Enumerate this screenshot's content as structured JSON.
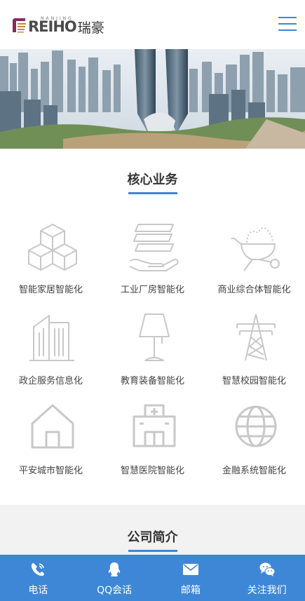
{
  "header": {
    "logo_en": "REIHO",
    "logo_sub": "NANJING",
    "logo_cn": "瑞豪",
    "menu_icon": "hamburger-menu-icon"
  },
  "core": {
    "title": "核心业务",
    "items": [
      {
        "label": "智能家居智能化",
        "icon": "cubes-icon"
      },
      {
        "label": "工业厂房智能化",
        "icon": "hand-layers-icon"
      },
      {
        "label": "商业综合体智能化",
        "icon": "wheelbarrow-icon"
      },
      {
        "label": "政企服务信息化",
        "icon": "buildings-icon"
      },
      {
        "label": "教育装备智能化",
        "icon": "lamp-icon"
      },
      {
        "label": "智慧校园智能化",
        "icon": "power-tower-icon"
      },
      {
        "label": "平安城市智能化",
        "icon": "house-icon"
      },
      {
        "label": "智慧医院智能化",
        "icon": "hospital-icon"
      },
      {
        "label": "金融系统智能化",
        "icon": "globe-icon"
      }
    ]
  },
  "company": {
    "title": "公司简介"
  },
  "bottom_bar": [
    {
      "label": "电话",
      "icon": "phone-icon"
    },
    {
      "label": "QQ会话",
      "icon": "qq-icon"
    },
    {
      "label": "邮箱",
      "icon": "mail-icon"
    },
    {
      "label": "关注我们",
      "icon": "wechat-icon"
    }
  ],
  "colors": {
    "accent": "#3d87d6",
    "icon_gray": "#c8c8c8"
  }
}
